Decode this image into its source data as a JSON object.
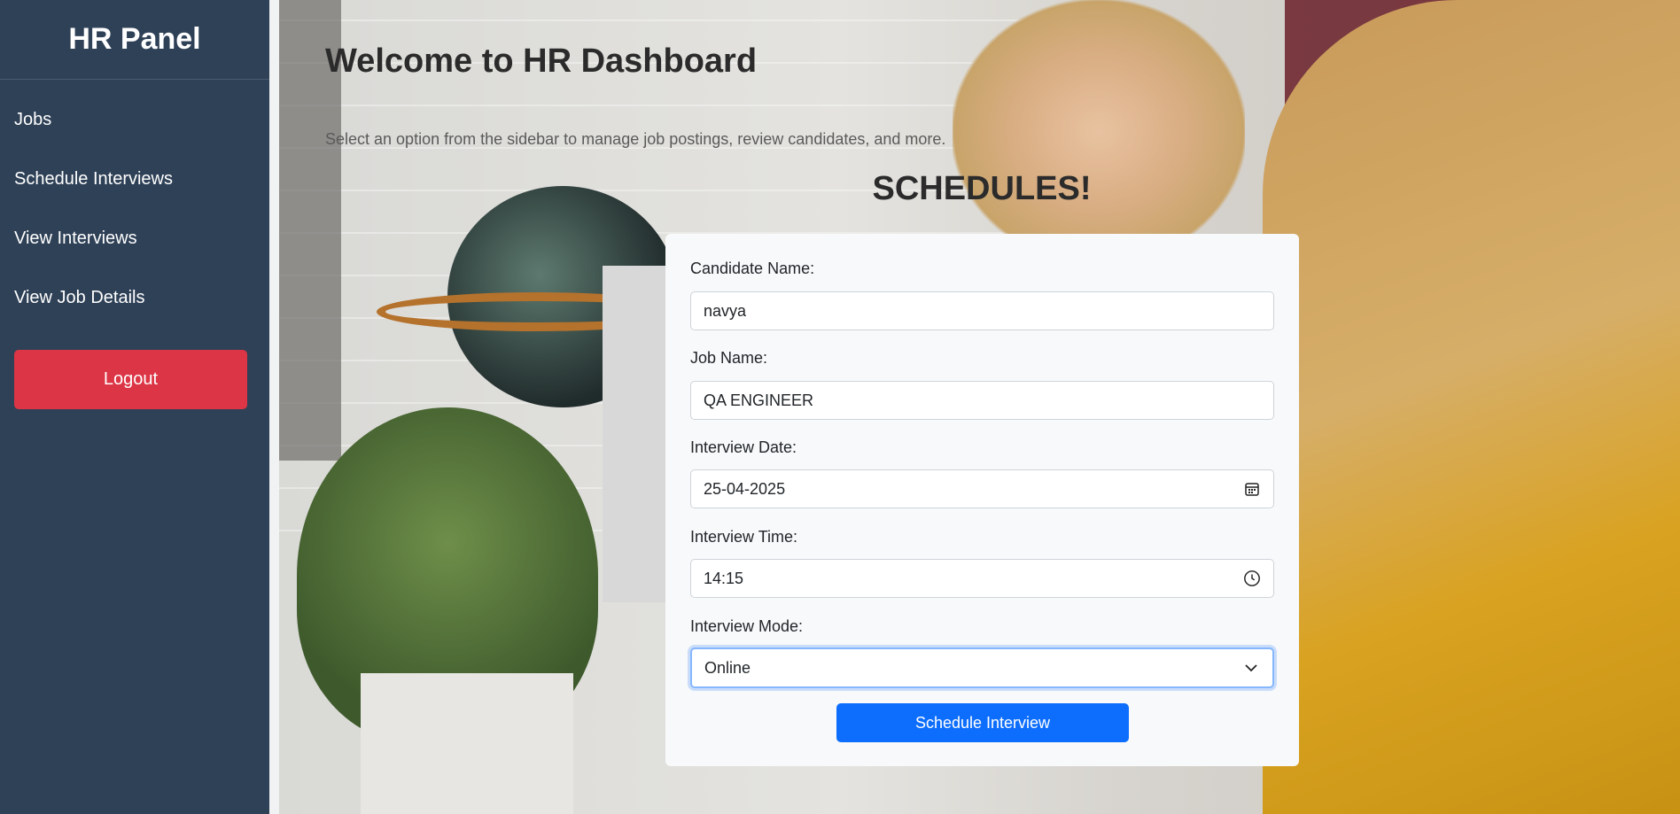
{
  "sidebar": {
    "title": "HR Panel",
    "items": [
      {
        "label": "Jobs"
      },
      {
        "label": "Schedule Interviews"
      },
      {
        "label": "View Interviews"
      },
      {
        "label": "View Job Details"
      }
    ],
    "logout_label": "Logout"
  },
  "main": {
    "welcome_title": "Welcome to HR Dashboard",
    "welcome_subtitle": "Select an option from the sidebar to manage job postings, review candidates, and more.",
    "section_title": "SCHEDULES!"
  },
  "form": {
    "candidate_name": {
      "label": "Candidate Name:",
      "value": "navya"
    },
    "job_name": {
      "label": "Job Name:",
      "value": "QA ENGINEER"
    },
    "interview_date": {
      "label": "Interview Date:",
      "value": "25-04-2025",
      "icon": "calendar-icon"
    },
    "interview_time": {
      "label": "Interview Time:",
      "value": "14:15",
      "icon": "clock-icon"
    },
    "interview_mode": {
      "label": "Interview Mode:",
      "value": "Online",
      "icon": "chevron-down-icon"
    },
    "submit_label": "Schedule Interview"
  },
  "colors": {
    "sidebar_bg": "#2f4157",
    "logout_bg": "#dc3545",
    "primary_button": "#0d6efd",
    "focus_ring": "#86b7fe"
  }
}
